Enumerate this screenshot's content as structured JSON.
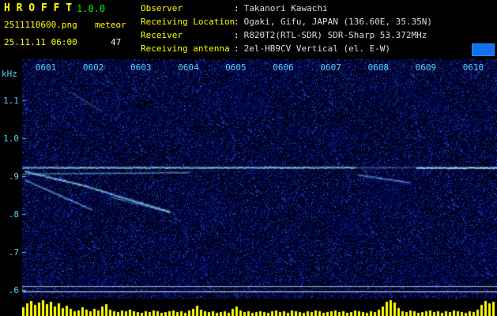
{
  "program": {
    "name": "H R O F F T",
    "version": "1.0.0",
    "filename": "2511110600.png",
    "mode": "meteor",
    "datetime": "25.11.11 06:00",
    "count": "47"
  },
  "station": {
    "colon": ":",
    "rows": [
      {
        "label": "Observer",
        "value": "Takanori Kawachi"
      },
      {
        "label": "Receiving Location",
        "value": "Ogaki, Gifu, JAPAN (136.60E, 35.35N)"
      },
      {
        "label": "Receiver",
        "value": "R820T2(RTL-SDR) SDR-Sharp 53.372MHz"
      },
      {
        "label": "Receiving antenna",
        "value": "2el-HB9CV Vertical (el. E-W)"
      }
    ]
  },
  "chart_data": {
    "type": "heatmap",
    "title": "HROFFT radio meteor spectrogram 06:00-06:10",
    "x_axis": {
      "ticks": [
        "0601",
        "0602",
        "0603",
        "0604",
        "0605",
        "0606",
        "0607",
        "0608",
        "0609",
        "0610"
      ],
      "minutes": 10
    },
    "y_axis": {
      "label": "kHz",
      "ticks": [
        "1.1",
        "1.0",
        ".9",
        ".8",
        ".7",
        ".6"
      ],
      "tick_khz": [
        1.1,
        1.0,
        0.9,
        0.8,
        0.7,
        0.6
      ],
      "range_khz": [
        0.577,
        1.208
      ]
    },
    "colors": {
      "background": "#000020",
      "noise": "#0030d0",
      "tick": "#4fd2ff",
      "bars": "#ffff00"
    },
    "traces": [
      {
        "name": "carrier-main",
        "points": [
          [
            0,
            0.923
          ],
          [
            7.0,
            0.923
          ]
        ],
        "color": "#9feaff",
        "alpha": 0.85,
        "width": 1.3
      },
      {
        "name": "carrier-faint",
        "points": [
          [
            7.0,
            0.923
          ],
          [
            8.3,
            0.923
          ]
        ],
        "color": "#9feaff",
        "alpha": 0.3,
        "width": 1.1
      },
      {
        "name": "carrier-right",
        "points": [
          [
            8.3,
            0.9225
          ],
          [
            10,
            0.9225
          ]
        ],
        "color": "#b8f0ff",
        "alpha": 0.95,
        "width": 1.4
      },
      {
        "name": "carrier-lower",
        "points": [
          [
            0,
            0.906
          ],
          [
            3.5,
            0.91
          ]
        ],
        "color": "#7fd0ff",
        "alpha": 0.5,
        "width": 1.1
      },
      {
        "name": "doppler-1",
        "points": [
          [
            0.05,
            0.913
          ],
          [
            1.3,
            0.875
          ],
          [
            3.1,
            0.806
          ]
        ],
        "color": "#8fe0ff",
        "alpha": 0.8,
        "width": 1.3
      },
      {
        "name": "doppler-2",
        "points": [
          [
            0.05,
            0.89
          ],
          [
            1.45,
            0.812
          ]
        ],
        "color": "#7fd0ff",
        "alpha": 0.6,
        "width": 1.2
      },
      {
        "name": "doppler-3",
        "points": [
          [
            1.85,
            0.846
          ],
          [
            3.1,
            0.805
          ]
        ],
        "color": "#7fd0ff",
        "alpha": 0.45,
        "width": 1.1
      },
      {
        "name": "doppler-dip",
        "points": [
          [
            7.05,
            0.904
          ],
          [
            8.15,
            0.883
          ]
        ],
        "color": "#8fe0ff",
        "alpha": 0.5,
        "width": 1.2
      },
      {
        "name": "faint-streak",
        "points": [
          [
            1.05,
            1.118
          ],
          [
            1.65,
            1.072
          ]
        ],
        "color": "#6fc0ff",
        "alpha": 0.3,
        "width": 1.0
      }
    ],
    "marker_lines": [
      {
        "khz": 0.61,
        "color": "#d8ecff",
        "alpha": 0.8
      },
      {
        "khz": 0.596,
        "color": "#ffffff",
        "alpha": 0.95
      }
    ],
    "activity_bars": {
      "color": "#ffff00",
      "values": [
        0.55,
        0.8,
        0.95,
        0.7,
        0.85,
        1.0,
        0.75,
        0.9,
        0.6,
        0.8,
        0.5,
        0.65,
        0.45,
        0.3,
        0.35,
        0.55,
        0.4,
        0.3,
        0.45,
        0.35,
        0.6,
        0.75,
        0.4,
        0.3,
        0.25,
        0.35,
        0.3,
        0.4,
        0.3,
        0.25,
        0.2,
        0.3,
        0.25,
        0.35,
        0.3,
        0.2,
        0.25,
        0.3,
        0.35,
        0.25,
        0.3,
        0.2,
        0.35,
        0.45,
        0.65,
        0.4,
        0.3,
        0.25,
        0.3,
        0.2,
        0.25,
        0.3,
        0.2,
        0.45,
        0.6,
        0.35,
        0.25,
        0.3,
        0.2,
        0.25,
        0.3,
        0.25,
        0.2,
        0.3,
        0.35,
        0.25,
        0.3,
        0.2,
        0.35,
        0.3,
        0.25,
        0.2,
        0.3,
        0.25,
        0.35,
        0.3,
        0.2,
        0.25,
        0.3,
        0.35,
        0.25,
        0.3,
        0.2,
        0.25,
        0.35,
        0.3,
        0.25,
        0.2,
        0.3,
        0.25,
        0.4,
        0.6,
        0.9,
        1.0,
        0.85,
        0.5,
        0.3,
        0.25,
        0.35,
        0.3,
        0.2,
        0.25,
        0.3,
        0.35,
        0.25,
        0.3,
        0.2,
        0.3,
        0.25,
        0.35,
        0.3,
        0.25,
        0.2,
        0.3,
        0.25,
        0.4,
        0.7,
        0.95,
        0.8,
        0.9
      ]
    }
  }
}
